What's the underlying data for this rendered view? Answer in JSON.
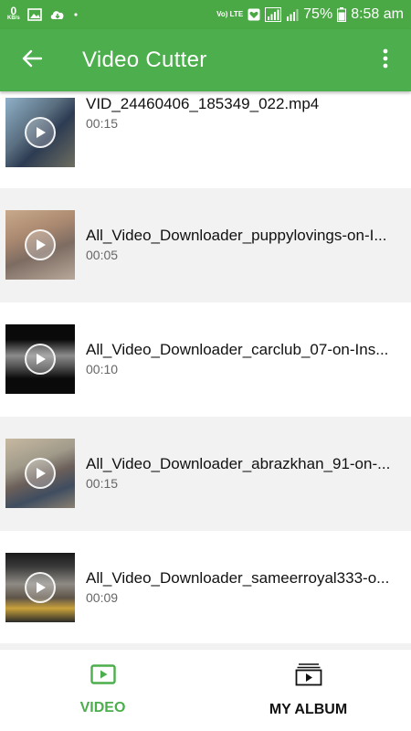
{
  "status_bar": {
    "net_speed": "0",
    "net_unit": "KB/s",
    "battery": "75%",
    "time": "8:58 am",
    "lte": "Vo) LTE"
  },
  "app_bar": {
    "title": "Video Cutter"
  },
  "videos": [
    {
      "name": "VID_24460406_185349_022.mp4",
      "duration": "00:15"
    },
    {
      "name": "All_Video_Downloader_puppylovings-on-I...",
      "duration": "00:05"
    },
    {
      "name": "All_Video_Downloader_carclub_07-on-Ins...",
      "duration": "00:10"
    },
    {
      "name": "All_Video_Downloader_abrazkhan_91-on-...",
      "duration": "00:15"
    },
    {
      "name": "All_Video_Downloader_sameerroyal333-o...",
      "duration": "00:09"
    }
  ],
  "bottom_nav": {
    "video_label": "VIDEO",
    "album_label": "MY ALBUM"
  },
  "colors": {
    "primary": "#4cae4c",
    "status_bar": "#4aa845",
    "active_tab": "#4cae4c",
    "inactive_tab": "#111111"
  }
}
